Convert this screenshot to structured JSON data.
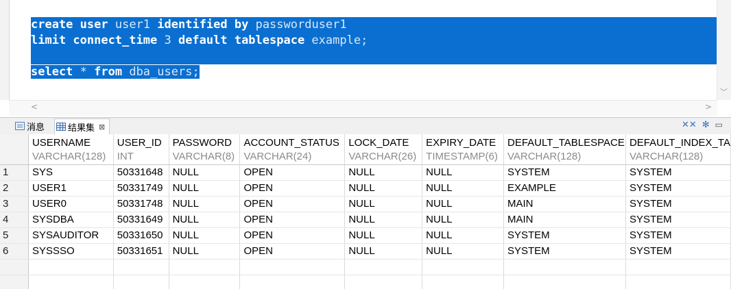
{
  "editor": {
    "lines": [
      [
        {
          "t": "create",
          "c": "kw"
        },
        {
          "t": " ",
          "c": "kw"
        },
        {
          "t": "user",
          "c": "kw"
        },
        {
          "t": " user1 ",
          "c": "nm"
        },
        {
          "t": "identified by",
          "c": "kw"
        },
        {
          "t": " passworduser1",
          "c": "nm"
        }
      ],
      [
        {
          "t": "limit connect_time",
          "c": "kw"
        },
        {
          "t": " 3 ",
          "c": "nm"
        },
        {
          "t": "default tablespace",
          "c": "kw"
        },
        {
          "t": " example;",
          "c": "nm"
        }
      ],
      [],
      [
        {
          "t": "select",
          "c": "kw"
        },
        {
          "t": " * ",
          "c": "nm"
        },
        {
          "t": "from",
          "c": "kw"
        },
        {
          "t": " dba_users;",
          "c": "nm"
        }
      ]
    ]
  },
  "tabs": {
    "messages_label": "消息",
    "results_label": "结果集",
    "close_glyph": "⊠"
  },
  "grid": {
    "columns": [
      {
        "name": "USERNAME",
        "type": "VARCHAR(128)"
      },
      {
        "name": "USER_ID",
        "type": "INT"
      },
      {
        "name": "PASSWORD",
        "type": "VARCHAR(8)"
      },
      {
        "name": "ACCOUNT_STATUS",
        "type": "VARCHAR(24)"
      },
      {
        "name": "LOCK_DATE",
        "type": "VARCHAR(26)"
      },
      {
        "name": "EXPIRY_DATE",
        "type": "TIMESTAMP(6)"
      },
      {
        "name": "DEFAULT_TABLESPACE",
        "type": "VARCHAR(128)"
      },
      {
        "name": "DEFAULT_INDEX_TA",
        "type": "VARCHAR(128)"
      }
    ],
    "rows": [
      [
        "1",
        "SYS",
        "50331648",
        "NULL",
        "OPEN",
        "NULL",
        "NULL",
        "SYSTEM",
        "SYSTEM"
      ],
      [
        "2",
        "USER1",
        "50331749",
        "NULL",
        "OPEN",
        "NULL",
        "NULL",
        "EXAMPLE",
        "SYSTEM"
      ],
      [
        "3",
        "USER0",
        "50331748",
        "NULL",
        "OPEN",
        "NULL",
        "NULL",
        "MAIN",
        "SYSTEM"
      ],
      [
        "4",
        "SYSDBA",
        "50331649",
        "NULL",
        "OPEN",
        "NULL",
        "NULL",
        "MAIN",
        "SYSTEM"
      ],
      [
        "5",
        "SYSAUDITOR",
        "50331650",
        "NULL",
        "OPEN",
        "NULL",
        "NULL",
        "SYSTEM",
        "SYSTEM"
      ],
      [
        "6",
        "SYSSSO",
        "50331651",
        "NULL",
        "OPEN",
        "NULL",
        "NULL",
        "SYSTEM",
        "SYSTEM"
      ]
    ]
  },
  "colors": {
    "selection": "#0a6fd1",
    "accent": "#3a6fc4"
  }
}
